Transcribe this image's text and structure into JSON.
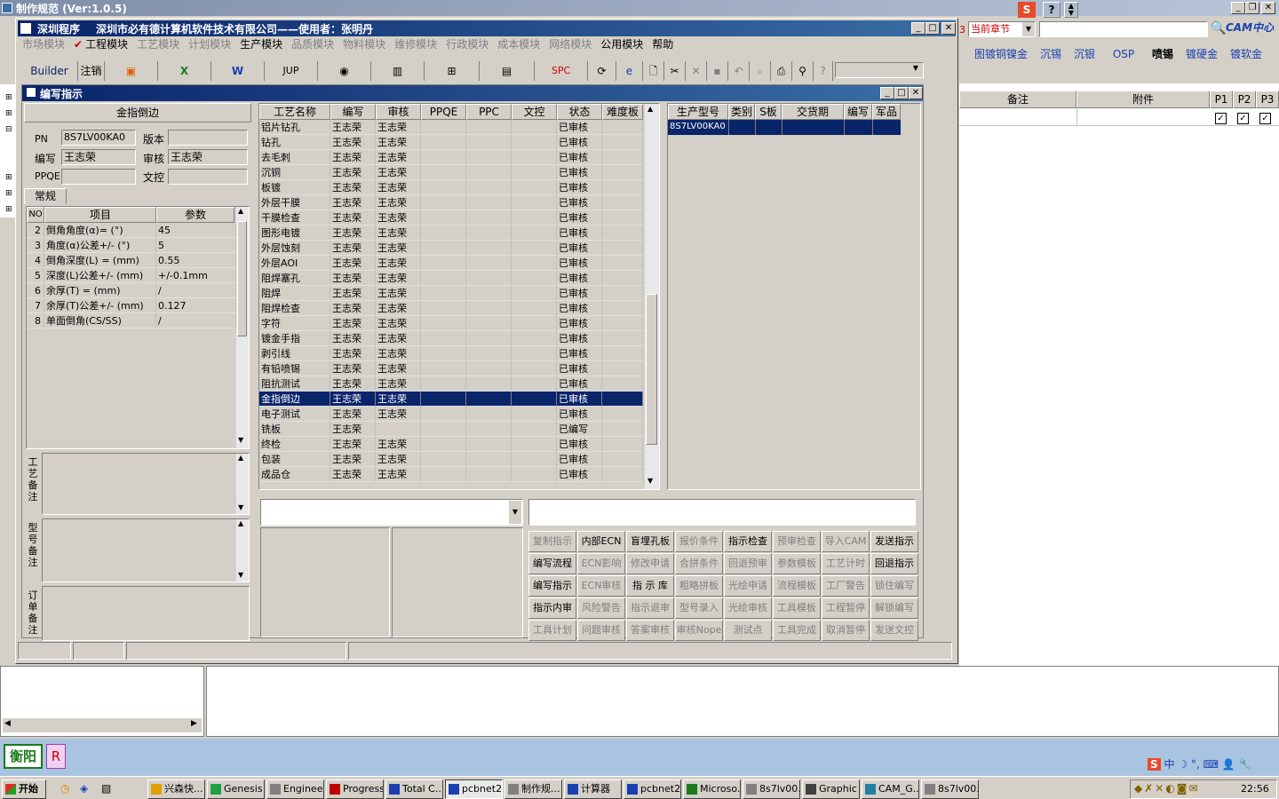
{
  "outer_title": "制作规范 (Ver:1.0.5)",
  "main_window": {
    "title_left": "深圳程序",
    "title_right": "深圳市必有德计算机软件技术有限公司——使用者：张明丹",
    "menu": [
      "市场模块",
      "工程模块",
      "工艺模块",
      "计划模块",
      "生产模块",
      "品质模块",
      "物料模块",
      "维修模块",
      "行政模块",
      "成本模块",
      "网络模块",
      "公用模块",
      "帮助"
    ],
    "toolbar": {
      "builder": "Builder",
      "logout": "注销",
      "jup": "JUP",
      "spc": "SPC"
    }
  },
  "right_panel": {
    "chapter_select": "当前章节",
    "chapter_prefix": "3",
    "cam_logo": "CAM中心",
    "tabs": [
      "图镀铜镍金",
      "沉锡",
      "沉银",
      "OSP",
      "喷锡",
      "镀硬金",
      "镀软金"
    ],
    "active_tab": "喷锡",
    "columns": [
      "备注",
      "附件",
      "P1",
      "P2",
      "P3"
    ],
    "row": {
      "p1": "✓",
      "p2": "✓",
      "p3": "✓"
    }
  },
  "dialog": {
    "title": "编写指示",
    "section_title": "金指倒边",
    "form": {
      "pn_label": "PN",
      "pn_value": "8S7LV00KA0",
      "version_label": "版本",
      "version_value": "",
      "writer_label": "编写",
      "writer_value": "王志荣",
      "reviewer_label": "审核",
      "reviewer_value": "王志荣",
      "ppqe_label": "PPQE",
      "ppqe_value": "",
      "wenkong_label": "文控",
      "wenkong_value": ""
    },
    "tab_general": "常规",
    "param_headers": [
      "NO",
      "项目",
      "参数"
    ],
    "params": [
      {
        "no": "2",
        "item": "倒角角度(α)=  (°)",
        "value": "45"
      },
      {
        "no": "3",
        "item": "角度(α)公差+/-  (°)",
        "value": "5"
      },
      {
        "no": "4",
        "item": "倒角深度(L) =  (mm)",
        "value": "0.55"
      },
      {
        "no": "5",
        "item": "深度(L)公差+/-  (mm)",
        "value": "+/-0.1mm"
      },
      {
        "no": "6",
        "item": "余厚(T) =  (mm)",
        "value": "/"
      },
      {
        "no": "7",
        "item": "余厚(T)公差+/-  (mm)",
        "value": "0.127"
      },
      {
        "no": "8",
        "item": "单面倒角(CS/SS)",
        "value": "/"
      }
    ],
    "note_labels": [
      "工艺备注",
      "型号备注",
      "订单备注"
    ],
    "process_headers": [
      "工艺名称",
      "编写",
      "审核",
      "PPQE",
      "PPC",
      "文控",
      "状态",
      "难度板"
    ],
    "processes": [
      {
        "name": "铝片钻孔",
        "writer": "王志荣",
        "reviewer": "王志荣",
        "status": "已审核"
      },
      {
        "name": "钻孔",
        "writer": "王志荣",
        "reviewer": "王志荣",
        "status": "已审核"
      },
      {
        "name": "去毛刺",
        "writer": "王志荣",
        "reviewer": "王志荣",
        "status": "已审核"
      },
      {
        "name": "沉铜",
        "writer": "王志荣",
        "reviewer": "王志荣",
        "status": "已审核"
      },
      {
        "name": "板镀",
        "writer": "王志荣",
        "reviewer": "王志荣",
        "status": "已审核"
      },
      {
        "name": "外层干膜",
        "writer": "王志荣",
        "reviewer": "王志荣",
        "status": "已审核"
      },
      {
        "name": "干膜检查",
        "writer": "王志荣",
        "reviewer": "王志荣",
        "status": "已审核"
      },
      {
        "name": "图形电镀",
        "writer": "王志荣",
        "reviewer": "王志荣",
        "status": "已审核"
      },
      {
        "name": "外层蚀刻",
        "writer": "王志荣",
        "reviewer": "王志荣",
        "status": "已审核"
      },
      {
        "name": "外层AOI",
        "writer": "王志荣",
        "reviewer": "王志荣",
        "status": "已审核"
      },
      {
        "name": "阻焊塞孔",
        "writer": "王志荣",
        "reviewer": "王志荣",
        "status": "已审核"
      },
      {
        "name": "阻焊",
        "writer": "王志荣",
        "reviewer": "王志荣",
        "status": "已审核"
      },
      {
        "name": "阻焊检查",
        "writer": "王志荣",
        "reviewer": "王志荣",
        "status": "已审核"
      },
      {
        "name": "字符",
        "writer": "王志荣",
        "reviewer": "王志荣",
        "status": "已审核"
      },
      {
        "name": "镀金手指",
        "writer": "王志荣",
        "reviewer": "王志荣",
        "status": "已审核"
      },
      {
        "name": "剥引线",
        "writer": "王志荣",
        "reviewer": "王志荣",
        "status": "已审核"
      },
      {
        "name": "有铅喷锡",
        "writer": "王志荣",
        "reviewer": "王志荣",
        "status": "已审核"
      },
      {
        "name": "阻抗测试",
        "writer": "王志荣",
        "reviewer": "王志荣",
        "status": "已审核"
      },
      {
        "name": "金指倒边",
        "writer": "王志荣",
        "reviewer": "王志荣",
        "status": "已审核"
      },
      {
        "name": "电子测试",
        "writer": "王志荣",
        "reviewer": "王志荣",
        "status": "已审核"
      },
      {
        "name": "铣板",
        "writer": "王志荣",
        "reviewer": "",
        "status": "已编写"
      },
      {
        "name": "终检",
        "writer": "王志荣",
        "reviewer": "王志荣",
        "status": "已审核"
      },
      {
        "name": "包装",
        "writer": "王志荣",
        "reviewer": "王志荣",
        "status": "已审核"
      },
      {
        "name": "成品仓",
        "writer": "王志荣",
        "reviewer": "王志荣",
        "status": "已审核"
      }
    ],
    "selected_process_index": 18,
    "model_headers": [
      "生产型号",
      "类别",
      "S板",
      "交货期",
      "编写",
      "军品"
    ],
    "model_row": "8S7LV00KA0",
    "actions": [
      [
        "复制指示",
        "内部ECN",
        "盲埋孔板",
        "报价条件",
        "指示检查",
        "预审检查",
        "导入CAM",
        "发送指示"
      ],
      [
        "编写流程",
        "ECN影响",
        "修改申请",
        "合拼条件",
        "回退预审",
        "参数模板",
        "工艺计时",
        "回退指示"
      ],
      [
        "编写指示",
        "ECN审核",
        "指 示 库",
        "粗略拼板",
        "光绘申请",
        "流程模板",
        "工厂警告",
        "锁住编写"
      ],
      [
        "指示内审",
        "风险警告",
        "指示退审",
        "型号录入",
        "光绘审核",
        "工具模板",
        "工程暂停",
        "解锁编写"
      ],
      [
        "工具计划",
        "问题审核",
        "答案审核",
        "审核Nope",
        "测试点",
        "工具完成",
        "取消暂停",
        "发送文控"
      ]
    ],
    "actions_enabled": [
      [
        false,
        true,
        true,
        false,
        true,
        false,
        false,
        true
      ],
      [
        true,
        false,
        false,
        false,
        false,
        false,
        false,
        true
      ],
      [
        true,
        false,
        true,
        false,
        false,
        false,
        false,
        false
      ],
      [
        true,
        false,
        false,
        false,
        false,
        false,
        false,
        false
      ],
      [
        false,
        false,
        false,
        false,
        false,
        false,
        false,
        false
      ]
    ]
  },
  "lower_left": {
    "city": "衡阳",
    "r": "R"
  },
  "taskbar": {
    "start": "开始",
    "items": [
      "兴森快...",
      "Genesis",
      "Enginee...",
      "Progress",
      "Total C...",
      "pcbnet2...",
      "制作规...",
      "计算器",
      "pcbnet2...",
      "Microso...",
      "8s7lv00...",
      "Graphic ...",
      "CAM_G...",
      "8s7lv00..."
    ],
    "clock": "22:56"
  }
}
